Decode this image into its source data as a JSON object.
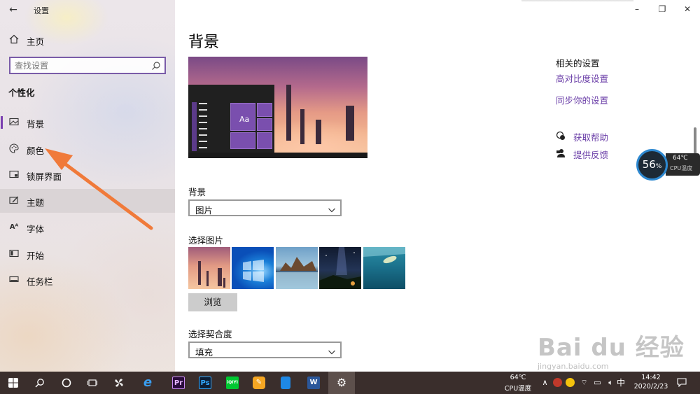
{
  "window": {
    "title": "设置",
    "controls": [
      "–",
      "❐",
      "✕"
    ]
  },
  "sidebar": {
    "home_label": "主页",
    "search_placeholder": "查找设置",
    "section_title": "个性化",
    "items": [
      {
        "label": "背景",
        "icon": "picture-icon"
      },
      {
        "label": "颜色",
        "icon": "palette-icon"
      },
      {
        "label": "锁屏界面",
        "icon": "lock-screen-icon"
      },
      {
        "label": "主题",
        "icon": "theme-icon"
      },
      {
        "label": "字体",
        "icon": "font-icon"
      },
      {
        "label": "开始",
        "icon": "start-icon"
      },
      {
        "label": "任务栏",
        "icon": "taskbar-icon"
      }
    ]
  },
  "main": {
    "page_title": "背景",
    "preview_tile_label": "Aa",
    "background_label": "背景",
    "background_value": "图片",
    "choose_picture_label": "选择图片",
    "browse_label": "浏览",
    "fit_label": "选择契合度",
    "fit_value": "填充"
  },
  "related": {
    "title": "相关的设置",
    "links": [
      "高对比度设置",
      "同步你的设置"
    ],
    "get_help": "获取帮助",
    "feedback": "提供反馈"
  },
  "cpu_widget": {
    "percent": "56",
    "percent_unit": "%",
    "temp": "64℃",
    "label": "CPU温度"
  },
  "taskbar": {
    "apps": [
      "Pr",
      "Ps",
      "iQIYI",
      "W"
    ],
    "cpu_temp": "64℃",
    "cpu_label": "CPU温度",
    "ime": "中",
    "time": "14:42",
    "date": "2020/2/23"
  },
  "watermark": {
    "text": "Bai du 经验",
    "sub": "jingyan.baidu.com"
  },
  "colors": {
    "accent": "#7a3fb0",
    "link": "#6b3fa8",
    "taskbar": "#3a2e2c",
    "arrow": "#f07a3a"
  }
}
